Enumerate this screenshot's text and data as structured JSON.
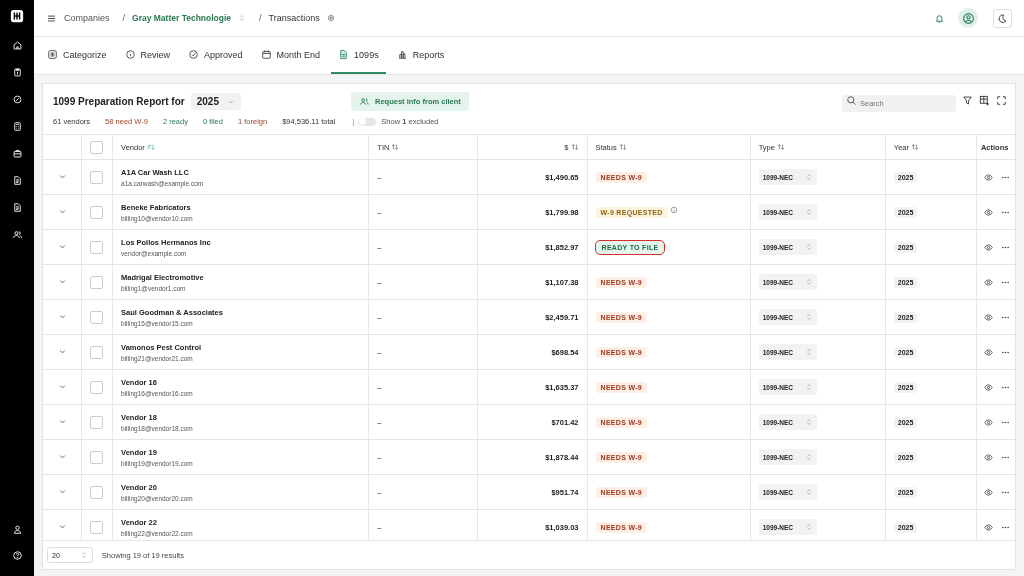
{
  "breadcrumbs": [
    {
      "label": "Companies",
      "kind": "link"
    },
    {
      "separator": "/",
      "label": "Gray Matter Technologie",
      "kind": "company"
    },
    {
      "separator": "/",
      "label": "Transactions",
      "kind": "page"
    }
  ],
  "tabs": [
    {
      "label": "Categorize",
      "selected": false
    },
    {
      "label": "Review",
      "selected": false
    },
    {
      "label": "Approved",
      "selected": false
    },
    {
      "label": "Month End",
      "selected": false
    },
    {
      "label": "1099s",
      "selected": true
    },
    {
      "label": "Reports",
      "selected": false
    }
  ],
  "report": {
    "title": "1099 Preparation Report for",
    "year": "2025",
    "request_button": "Request info from client",
    "stats": [
      {
        "text": "61 vendors",
        "kind": "neutral"
      },
      {
        "text": "58 need W-9",
        "kind": "warning"
      },
      {
        "text": "2 ready",
        "kind": "success"
      },
      {
        "text": "0 filed",
        "kind": "success"
      },
      {
        "text": "1 foreign",
        "kind": "warning"
      },
      {
        "text": "$94,536.11 total",
        "kind": "neutral"
      }
    ],
    "divider": "|",
    "toggle": {
      "label": "Show **1** excluded",
      "on": false
    },
    "search": {
      "placeholder": "Search"
    }
  },
  "select_all": {
    "checked": false
  },
  "columns": [
    "Vendor",
    "TIN",
    "$",
    "Status",
    "Type",
    "Year",
    "Actions"
  ],
  "rows": [
    {
      "checked": false,
      "vendor": "A1A Car Wash LLC",
      "email": "a1a.carwash@example.com",
      "tin": "–",
      "amount": "$1,490.65",
      "status": {
        "label": "NEEDS W-9",
        "kind": "needs",
        "highlighted": false
      },
      "type": "1099-NEC",
      "year": "2025"
    },
    {
      "checked": false,
      "vendor": "Beneke Fabricators",
      "email": "billing10@vendor10.com",
      "tin": "–",
      "amount": "$1,799.98",
      "status": {
        "label": "W-9 REQUESTED",
        "kind": "requested",
        "highlighted": false
      },
      "type": "1099-NEC",
      "year": "2025"
    },
    {
      "checked": false,
      "vendor": "Los Pollos Hermanos Inc",
      "email": "vendor@example.com",
      "tin": "–",
      "amount": "$1,852.97",
      "status": {
        "label": "READY TO FILE",
        "kind": "ready",
        "highlighted": true
      },
      "type": "1099-NEC",
      "year": "2025"
    },
    {
      "checked": false,
      "vendor": "Madrigal Electromotive",
      "email": "billing1@vendor1.com",
      "tin": "–",
      "amount": "$1,107.38",
      "status": {
        "label": "NEEDS W-9",
        "kind": "needs",
        "highlighted": false
      },
      "type": "1099-NEC",
      "year": "2025"
    },
    {
      "checked": false,
      "vendor": "Saul Goodman & Associates",
      "email": "billing15@vendor15.com",
      "tin": "–",
      "amount": "$2,459.71",
      "status": {
        "label": "NEEDS W-9",
        "kind": "needs",
        "highlighted": false
      },
      "type": "1099-NEC",
      "year": "2025"
    },
    {
      "checked": false,
      "vendor": "Vamonos Pest Control",
      "email": "billing21@vendor21.com",
      "tin": "–",
      "amount": "$698.54",
      "status": {
        "label": "NEEDS W-9",
        "kind": "needs",
        "highlighted": false
      },
      "type": "1099-NEC",
      "year": "2025"
    },
    {
      "checked": false,
      "vendor": "Vendor 16",
      "email": "billing16@vendor16.com",
      "tin": "–",
      "amount": "$1,635.37",
      "status": {
        "label": "NEEDS W-9",
        "kind": "needs",
        "highlighted": false
      },
      "type": "1099-NEC",
      "year": "2025"
    },
    {
      "checked": false,
      "vendor": "Vendor 18",
      "email": "billing18@vendor18.com",
      "tin": "–",
      "amount": "$701.42",
      "status": {
        "label": "NEEDS W-9",
        "kind": "needs",
        "highlighted": false
      },
      "type": "1099-NEC",
      "year": "2025"
    },
    {
      "checked": false,
      "vendor": "Vendor 19",
      "email": "billing19@vendor19.com",
      "tin": "–",
      "amount": "$1,878.44",
      "status": {
        "label": "NEEDS W-9",
        "kind": "needs",
        "highlighted": false
      },
      "type": "1099-NEC",
      "year": "2025"
    },
    {
      "checked": false,
      "vendor": "Vendor 20",
      "email": "billing20@vendor20.com",
      "tin": "–",
      "amount": "$951.74",
      "status": {
        "label": "NEEDS W-9",
        "kind": "needs",
        "highlighted": false
      },
      "type": "1099-NEC",
      "year": "2025"
    },
    {
      "checked": false,
      "vendor": "Vendor 22",
      "email": "billing22@vendor22.com",
      "tin": "–",
      "amount": "$1,039.03",
      "status": {
        "label": "NEEDS W-9",
        "kind": "needs",
        "highlighted": false
      },
      "type": "1099-NEC",
      "year": "2025"
    }
  ],
  "footer": {
    "page_size": "20",
    "summary": "Showing 19 of 19 results"
  }
}
